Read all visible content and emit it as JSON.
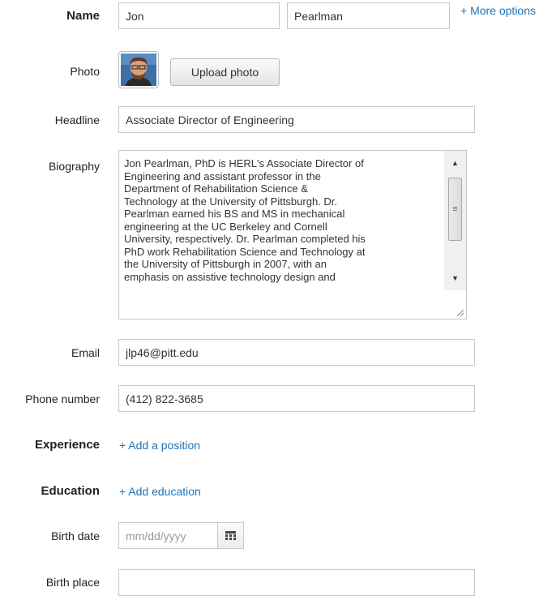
{
  "name": {
    "label": "Name",
    "first_value": "Jon",
    "last_value": "Pearlman",
    "more_options": "+ More options"
  },
  "photo": {
    "label": "Photo",
    "upload_label": "Upload photo"
  },
  "headline": {
    "label": "Headline",
    "value": "Associate Director of Engineering"
  },
  "biography": {
    "label": "Biography",
    "value": "Jon Pearlman, PhD is HERL's Associate Director of\nEngineering and assistant professor in the\nDepartment of Rehabilitation Science &\nTechnology at the University of Pittsburgh.  Dr.\nPearlman earned his BS and MS in mechanical\nengineering at the UC Berkeley and Cornell\nUniversity, respectively.  Dr. Pearlman completed his\nPhD work Rehabilitation Science and Technology at\nthe University of Pittsburgh in 2007, with an\nemphasis on assistive technology design and"
  },
  "email": {
    "label": "Email",
    "value": "jlp46@pitt.edu"
  },
  "phone": {
    "label": "Phone number",
    "value": "(412) 822-3685"
  },
  "experience": {
    "label": "Experience",
    "add_label": "+ Add a position"
  },
  "education": {
    "label": "Education",
    "add_label": "+ Add education"
  },
  "birth_date": {
    "label": "Birth date",
    "placeholder": "mm/dd/yyyy",
    "icon": "calendar-icon"
  },
  "birth_place": {
    "label": "Birth place",
    "value": ""
  },
  "colors": {
    "link": "#1b73b8",
    "border": "#c8c8c8"
  }
}
